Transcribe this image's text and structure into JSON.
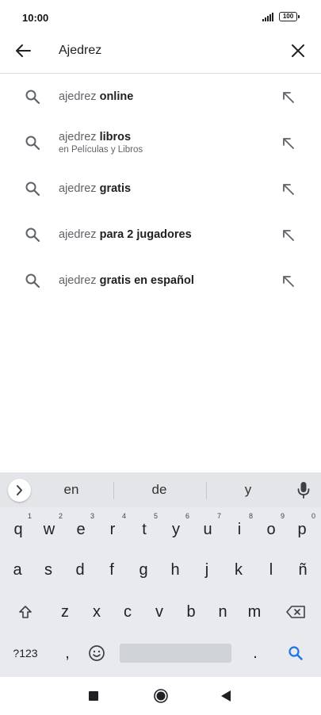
{
  "status_bar": {
    "time": "10:00",
    "battery": "100",
    "icons": [
      "signal-icon",
      "battery-icon"
    ]
  },
  "search": {
    "query": "Ajedrez",
    "icons": [
      "back-arrow-icon",
      "clear-icon"
    ]
  },
  "suggestions": [
    {
      "prefix": "ajedrez",
      "bold": "online",
      "subtitle": ""
    },
    {
      "prefix": "ajedrez",
      "bold": "libros",
      "subtitle": "en Películas y Libros"
    },
    {
      "prefix": "ajedrez",
      "bold": "gratis",
      "subtitle": ""
    },
    {
      "prefix": "ajedrez",
      "bold": "para 2 jugadores",
      "subtitle": ""
    },
    {
      "prefix": "ajedrez",
      "bold": "gratis en español",
      "subtitle": ""
    }
  ],
  "keyboard": {
    "word_suggestions": [
      "en",
      "de",
      "y"
    ],
    "row1": [
      {
        "k": "q",
        "n": "1"
      },
      {
        "k": "w",
        "n": "2"
      },
      {
        "k": "e",
        "n": "3"
      },
      {
        "k": "r",
        "n": "4"
      },
      {
        "k": "t",
        "n": "5"
      },
      {
        "k": "y",
        "n": "6"
      },
      {
        "k": "u",
        "n": "7"
      },
      {
        "k": "i",
        "n": "8"
      },
      {
        "k": "o",
        "n": "9"
      },
      {
        "k": "p",
        "n": "0"
      }
    ],
    "row2": [
      "a",
      "s",
      "d",
      "f",
      "g",
      "h",
      "j",
      "k",
      "l",
      "ñ"
    ],
    "row3": [
      "z",
      "x",
      "c",
      "v",
      "b",
      "n",
      "m"
    ],
    "symbols_key": "?123",
    "comma_key": ",",
    "period_key": ".",
    "icons": [
      "expand-icon",
      "microphone-icon",
      "shift-icon",
      "backspace-icon",
      "emoji-icon",
      "search-key-icon"
    ],
    "accent_color": "#1a73e8"
  },
  "nav_bar": {
    "icons": [
      "recents-icon",
      "home-icon",
      "back-icon"
    ]
  }
}
